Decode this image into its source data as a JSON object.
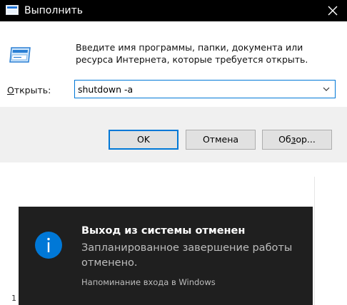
{
  "run_dialog": {
    "title": "Выполнить",
    "description": "Введите имя программы, папки, документа или ресурса Интернета, которые требуется открыть.",
    "open_label_prefix": "О",
    "open_label_rest": "ткрыть:",
    "command_value": "shutdown -a",
    "buttons": {
      "ok": "OK",
      "cancel": "Отмена",
      "browse_pre": "Об",
      "browse_ul": "з",
      "browse_post": "ор..."
    },
    "icons": {
      "app": "run-app-icon",
      "close": "close-icon",
      "run": "run-window-icon",
      "dropdown": "chevron-down-icon"
    }
  },
  "toast": {
    "title": "Выход из системы отменен",
    "body": "Запланированное завершение работы отменено.",
    "source": "Напоминание входа в Windows",
    "icon": "info-icon",
    "accent": "#0078d7"
  },
  "desktop": {
    "fragment": "1"
  },
  "colors": {
    "accent": "#0078d7",
    "titlebar": "#000000",
    "button_bar": "#f0f0f0",
    "toast_bg": "#1f1f1f"
  }
}
